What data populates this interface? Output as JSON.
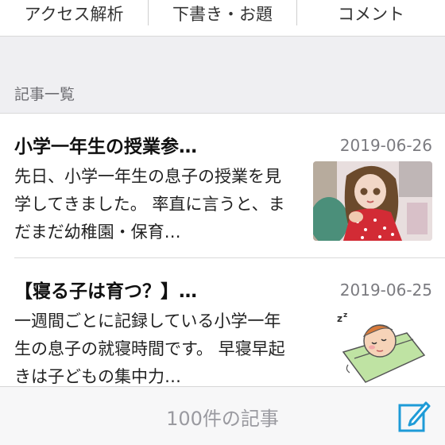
{
  "tabs": [
    {
      "label": "アクセス解析"
    },
    {
      "label": "下書き・お題"
    },
    {
      "label": "コメント"
    }
  ],
  "section": {
    "title": "記事一覧"
  },
  "articles": [
    {
      "title": "小学一年生の授業参…",
      "date": "2019-06-26",
      "excerpt": "先日、小学一年生の息子の授業を見学してきました。 率直に言うと、まだまだ幼稚園・保育…",
      "thumbnail": "doll-photo"
    },
    {
      "title": "【寝る子は育つ？】…",
      "date": "2019-06-25",
      "excerpt": "一週間ごとに記録している小学一年生の息子の就寝時間です。 早寝早起きは子どもの集中力…",
      "thumbnail": "sleeping-child-illustration"
    }
  ],
  "footer": {
    "count_label": "100件の記事",
    "compose_icon": "compose-icon"
  },
  "colors": {
    "accent": "#1e9bd7",
    "background_gray": "#efeff2",
    "date_text": "#7b7b80"
  }
}
